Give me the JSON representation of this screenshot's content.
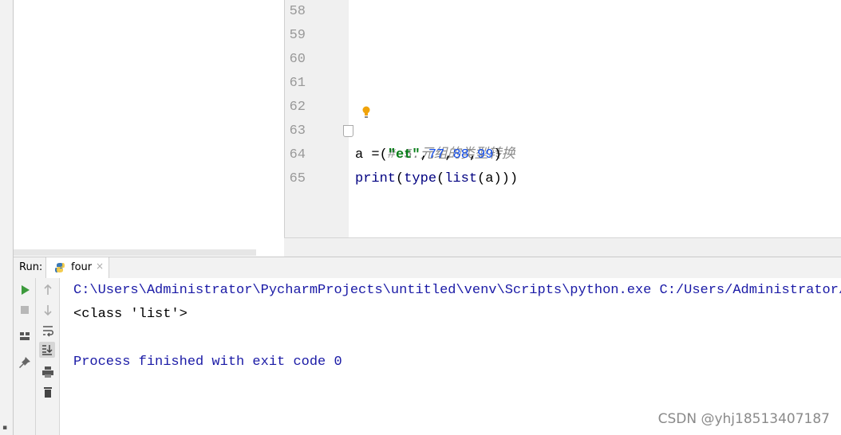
{
  "editor": {
    "line_numbers": [
      "58",
      "59",
      "60",
      "61",
      "62",
      "63",
      "64",
      "65"
    ],
    "code": {
      "line63_comment": "# 5.元组的类型转换",
      "line64": {
        "var": "a =(",
        "str": "\"et\"",
        "comma1": ",",
        "n1": "77",
        "comma2": ",",
        "n2": "88",
        "comma3": ",",
        "n3": "99",
        "close": ")"
      },
      "line65": {
        "fn_print": "print",
        "p1": "(",
        "fn_type": "type",
        "p2": "(",
        "fn_list": "list",
        "rest": "(a)))"
      }
    },
    "current_line": "63"
  },
  "run_panel": {
    "label": "Run:",
    "tab_label": "four",
    "tab_close": "×"
  },
  "console": {
    "lines": [
      "C:\\Users\\Administrator\\PycharmProjects\\untitled\\venv\\Scripts\\python.exe C:/Users/Administrator/P",
      "<class 'list'>",
      "",
      "Process finished with exit code 0"
    ]
  },
  "watermark": "CSDN @yhj18513407187",
  "colors": {
    "comment": "#8c8c8c",
    "string": "#067d17",
    "number": "#1750eb",
    "builtin": "#000080",
    "console_command": "#1a1aa6",
    "current_line_bg": "#fcf8e3"
  },
  "icons": {
    "run": "play-icon",
    "stop": "stop-icon",
    "up": "arrow-up-icon",
    "down": "arrow-down-icon",
    "wrap": "soft-wrap-icon",
    "scroll": "scroll-to-end-icon",
    "print": "print-icon",
    "trash": "trash-icon",
    "layout": "layout-icon",
    "pin": "pin-icon",
    "bulb": "lightbulb-icon",
    "python": "python-icon"
  }
}
